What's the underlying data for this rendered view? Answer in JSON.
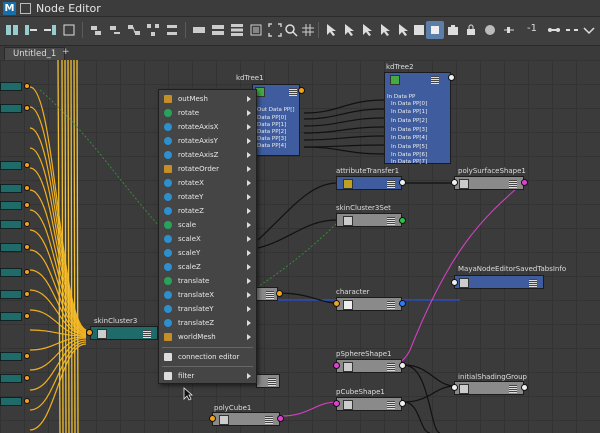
{
  "window": {
    "title": "Node Editor",
    "logo": "M"
  },
  "toolbar": {
    "field_value": "-1"
  },
  "tabs": [
    {
      "label": "Untitled_1"
    }
  ],
  "tab_add": "+",
  "nodes": {
    "kdtree1": {
      "name": "kdTree1",
      "attrs": [
        "Out Data PP[]",
        "Data PP[0]",
        "Data PP[1]",
        "Data PP[2]",
        "Data PP[3]",
        "Data PP[4]"
      ]
    },
    "kdtree2": {
      "name": "kdTree2",
      "attrs": [
        "In Data PP",
        "In Data PP[0]",
        "In Data PP[1]",
        "In Data PP[2]",
        "In Data PP[3]",
        "In Data PP[4]",
        "In Data PP[5]",
        "In Data PP[6]",
        "In Data PP[7]"
      ]
    },
    "attribute_transfer": {
      "name": "attributeTransfer1"
    },
    "poly_surface_shape": {
      "name": "polySurfaceShape1"
    },
    "skin_cluster_set": {
      "name": "skinCluster3Set"
    },
    "saved_tabs_info": {
      "name": "MayaNodeEditorSavedTabsInfo"
    },
    "character": {
      "name": "character"
    },
    "skin_cluster": {
      "name": "skinCluster3"
    },
    "psphere_shape": {
      "name": "pSphereShape1"
    },
    "pcube_shape": {
      "name": "pCubeShape1"
    },
    "shading_group": {
      "name": "initialShadingGroup"
    },
    "poly_cube": {
      "name": "polyCube1"
    }
  },
  "context_menu": {
    "items": [
      {
        "label": "outMesh",
        "icon": "square-icon"
      },
      {
        "label": "rotate",
        "icon": "vector-icon"
      },
      {
        "label": "rotateAxisX",
        "icon": "circle-icon"
      },
      {
        "label": "rotateAxisY",
        "icon": "circle-icon"
      },
      {
        "label": "rotateAxisZ",
        "icon": "circle-icon"
      },
      {
        "label": "rotateOrder",
        "icon": "square-icon"
      },
      {
        "label": "rotateX",
        "icon": "circle-icon"
      },
      {
        "label": "rotateY",
        "icon": "circle-icon"
      },
      {
        "label": "rotateZ",
        "icon": "circle-icon"
      },
      {
        "label": "scale",
        "icon": "vector-icon"
      },
      {
        "label": "scaleX",
        "icon": "circle-icon"
      },
      {
        "label": "scaleY",
        "icon": "circle-icon"
      },
      {
        "label": "scaleZ",
        "icon": "circle-icon"
      },
      {
        "label": "translate",
        "icon": "vector-icon"
      },
      {
        "label": "translateX",
        "icon": "circle-icon"
      },
      {
        "label": "translateY",
        "icon": "circle-icon"
      },
      {
        "label": "translateZ",
        "icon": "circle-icon"
      },
      {
        "label": "worldMesh",
        "icon": "square-icon"
      }
    ],
    "connection_editor": "connection editor",
    "filter": "filter"
  }
}
